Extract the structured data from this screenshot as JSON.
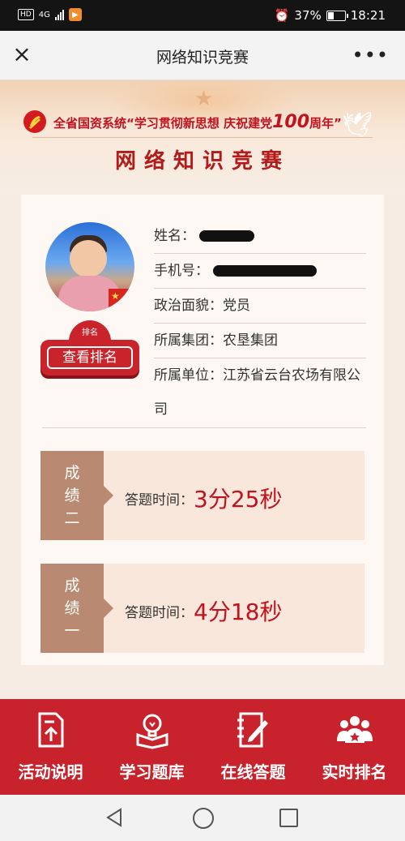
{
  "status_bar": {
    "left": {
      "hd": "HD",
      "net": "4G",
      "app_badge": "▶"
    },
    "battery": "37%",
    "time": "18:21"
  },
  "navbar": {
    "close": "×",
    "title": "网络知识竞赛",
    "more": "•••"
  },
  "banner": {
    "slogan_prefix": "全省国资系统“学习贯彻新思想 庆祝建党",
    "slogan_num": "100",
    "slogan_suffix": "周年”",
    "game_title": "网络知识竞赛"
  },
  "profile": {
    "avatar_flag": "★",
    "rank_badge_small": "排名",
    "rank_button": "查看排名",
    "fields": [
      {
        "label": "姓名：",
        "value": ""
      },
      {
        "label": "手机号：",
        "value": ""
      },
      {
        "label": "政治面貌：",
        "value": "党员"
      },
      {
        "label": "所属集团：",
        "value": "农垦集团"
      },
      {
        "label": "所属单位：",
        "value": "江苏省云台农场有限公司"
      }
    ]
  },
  "scores": [
    {
      "tag": "成\n绩\n二",
      "tag_lines": [
        "成",
        "绩",
        "二"
      ],
      "label": "答题时间：",
      "value": "3分25秒"
    },
    {
      "tag": "成\n绩\n一",
      "tag_lines": [
        "成",
        "绩",
        "一"
      ],
      "label": "答题时间：",
      "value": "4分18秒"
    }
  ],
  "tabs": [
    {
      "label": "活动说明",
      "icon": "document-upload-icon"
    },
    {
      "label": "学习题库",
      "icon": "book-bulb-icon"
    },
    {
      "label": "在线答题",
      "icon": "edit-notebook-icon"
    },
    {
      "label": "实时排名",
      "icon": "group-ranking-icon"
    }
  ],
  "colors": {
    "brand_red": "#c8232c",
    "score_tag": "#b98a71",
    "score_value": "#c1121f"
  }
}
